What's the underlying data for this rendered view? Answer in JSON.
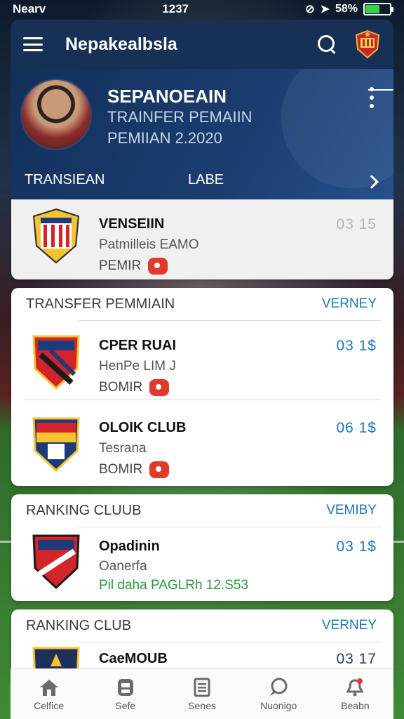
{
  "status": {
    "carrier": "Nearv",
    "time": "1237",
    "battery": "58%",
    "battery_level": 0.58
  },
  "header": {
    "title": "Nepakealbsla"
  },
  "hero": {
    "name": "SEPANOEAIN",
    "subtitle": "TRAINFER PEMAIIN",
    "season": "PEMIIAN 2.2020",
    "tab_left": "TRANSIEAN",
    "tab_right": "LABE"
  },
  "featured": {
    "title": "VENSEIIN",
    "sub": "Patmilleis EAMO",
    "meta": "PEMIR",
    "numbers": "03 15"
  },
  "sections": [
    {
      "heading": "TRANSFER PEMMIAIN",
      "link": "VERNEY",
      "rows": [
        {
          "title": "CPER RUAI",
          "sub": "HenPe LIM J",
          "meta": "BOMIR",
          "numbers": "03 1$"
        },
        {
          "title": "OLOIK CLUB",
          "sub": "Tesrana",
          "meta": "BOMIR",
          "numbers": "06 1$"
        }
      ]
    },
    {
      "heading": "RANKING CLUUB",
      "link": "VEMIBY",
      "rows": [
        {
          "title": "Opadinin",
          "sub": "Oanerfa",
          "meta": "Pil daha PAGLRh 12.S53",
          "numbers": "03 1$"
        }
      ]
    },
    {
      "heading": "RANKING CLUB",
      "link": "VERNEY",
      "rows": [
        {
          "title": "CaeMOUB",
          "sub": "",
          "meta": "",
          "numbers": "03 17"
        }
      ]
    }
  ],
  "nav": [
    {
      "label": "Celfice",
      "icon": "home-icon"
    },
    {
      "label": "Sefe",
      "icon": "jersey-icon"
    },
    {
      "label": "Senes",
      "icon": "list-icon"
    },
    {
      "label": "Nuonigo",
      "icon": "chat-icon"
    },
    {
      "label": "Beabn",
      "icon": "bell-icon"
    }
  ]
}
